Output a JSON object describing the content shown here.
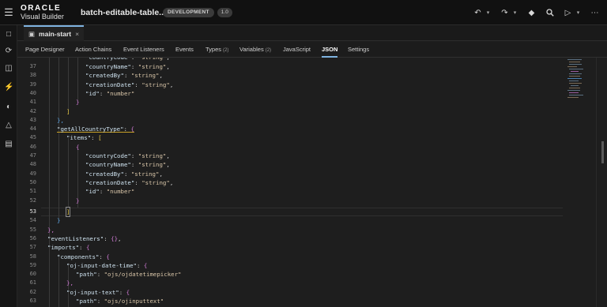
{
  "header": {
    "brand_line1": "ORACLE",
    "brand_line2": "Visual Builder",
    "app_name": "batch-editable-table...",
    "env_badge": "DEVELOPMENT",
    "version_badge": "1.0"
  },
  "file_tab": {
    "label": "main-start"
  },
  "nav_tabs": [
    {
      "label": "Page Designer"
    },
    {
      "label": "Action Chains"
    },
    {
      "label": "Event Listeners"
    },
    {
      "label": "Events"
    },
    {
      "label": "Types",
      "count": "(2)"
    },
    {
      "label": "Variables",
      "count": "(2)"
    },
    {
      "label": "JavaScript"
    },
    {
      "label": "JSON",
      "active": true
    },
    {
      "label": "Settings"
    }
  ],
  "editor": {
    "current_line": "53",
    "lines": [
      {
        "n": "37",
        "text": "\"countryName\": \"string\","
      },
      {
        "n": "38",
        "text": "\"createdBy\": \"string\","
      },
      {
        "n": "39",
        "text": "\"creationDate\": \"string\","
      },
      {
        "n": "40",
        "text": "\"id\": \"number\""
      },
      {
        "n": "41",
        "text": "}"
      },
      {
        "n": "42",
        "text": "]"
      },
      {
        "n": "43",
        "text": "},"
      },
      {
        "n": "44",
        "text": "\"getAllCountryType\": {"
      },
      {
        "n": "45",
        "text": "\"items\": ["
      },
      {
        "n": "46",
        "text": "{"
      },
      {
        "n": "47",
        "text": "\"countryCode\": \"string\","
      },
      {
        "n": "48",
        "text": "\"countryName\": \"string\","
      },
      {
        "n": "49",
        "text": "\"createdBy\": \"string\","
      },
      {
        "n": "50",
        "text": "\"creationDate\": \"string\","
      },
      {
        "n": "51",
        "text": "\"id\": \"number\""
      },
      {
        "n": "52",
        "text": "}"
      },
      {
        "n": "53",
        "text": "]"
      },
      {
        "n": "54",
        "text": "}"
      },
      {
        "n": "55",
        "text": "},"
      },
      {
        "n": "56",
        "text": "\"eventListeners\": {},"
      },
      {
        "n": "57",
        "text": "\"imports\": {"
      },
      {
        "n": "58",
        "text": "\"components\": {"
      },
      {
        "n": "59",
        "text": "\"oj-input-date-time\": {"
      },
      {
        "n": "60",
        "text": "\"path\": \"ojs/ojdatetimepicker\""
      },
      {
        "n": "61",
        "text": "},"
      },
      {
        "n": "62",
        "text": "\"oj-input-text\": {"
      },
      {
        "n": "63",
        "text": "\"path\": \"ojs/ojinputtext\""
      }
    ]
  },
  "colors": {
    "accent": "#7fb3e0",
    "bracket_gold": "#f2d24a",
    "bracket_purple": "#d17bd6",
    "bracket_blue": "#5fa8e8",
    "string": "#d8c5a8",
    "key": "#cfe3f0"
  },
  "icons": {
    "menu": "hamburger-icon",
    "undo": "undo-icon",
    "redo": "redo-icon",
    "share": "diamond-icon",
    "search": "search-icon",
    "run": "play-icon",
    "more": "more-icon"
  }
}
